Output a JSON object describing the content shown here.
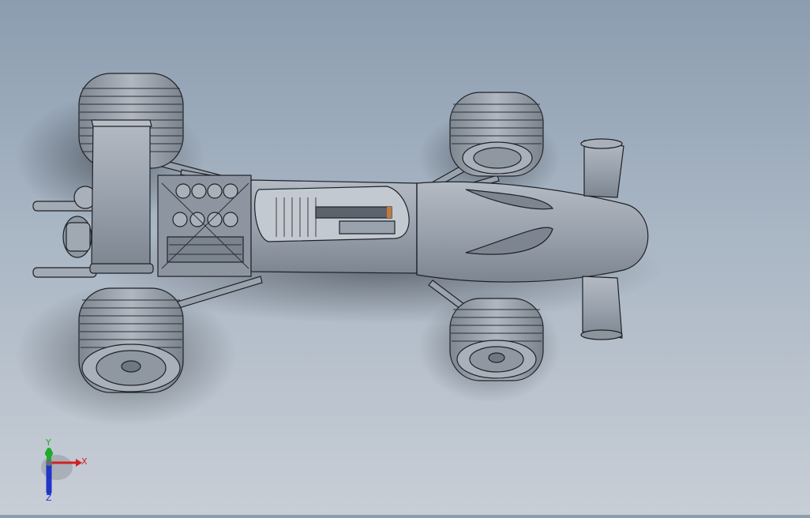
{
  "viewport": {
    "model_icon": "race-car-model",
    "background_colors": [
      "#8c9db0",
      "#c8ced6"
    ],
    "model_color": "#9aa2ad",
    "edge_color": "#1e2228"
  },
  "triad": {
    "x_label": "X",
    "y_label": "Y",
    "z_label": "Z",
    "x_color": "#d42020",
    "y_color": "#1faa2a",
    "z_color": "#2233c8"
  }
}
